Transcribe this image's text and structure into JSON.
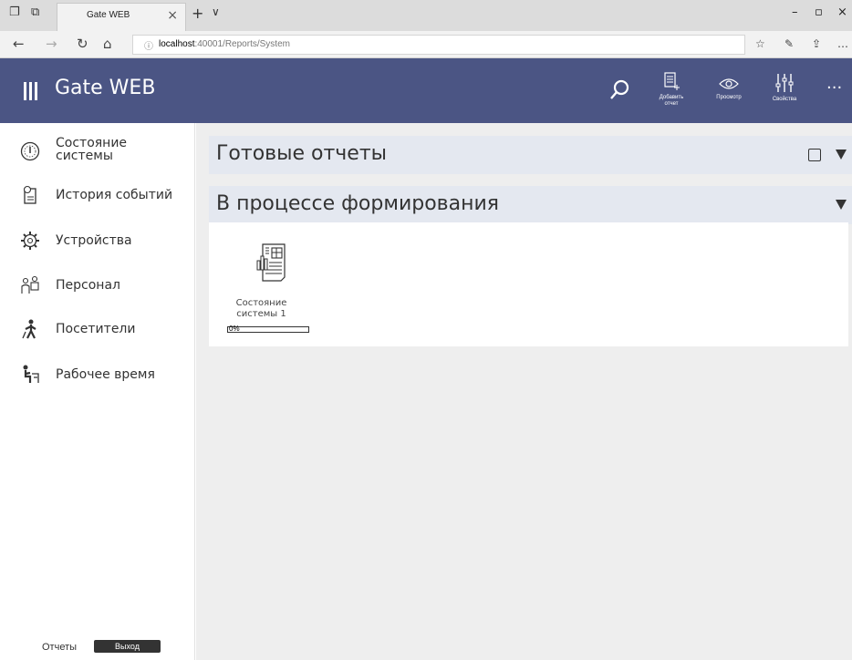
{
  "browser": {
    "tab_title": "Gate WEB",
    "url_host": "localhost",
    "url_path": ":40001/Reports/System"
  },
  "header": {
    "title": "Gate WEB",
    "buttons": {
      "add_report": "Добавить отчет",
      "preview": "Просмотр",
      "properties": "Свойства"
    }
  },
  "sidebar": {
    "items": [
      {
        "label": "Состояние системы",
        "icon": "gauge-icon"
      },
      {
        "label": "История событий",
        "icon": "history-icon"
      },
      {
        "label": "Устройства",
        "icon": "gear-icon"
      },
      {
        "label": "Персонал",
        "icon": "staff-icon"
      },
      {
        "label": "Посетители",
        "icon": "visitor-icon"
      },
      {
        "label": "Рабочее время",
        "icon": "worktime-icon"
      }
    ],
    "footer": {
      "reports_label": "Отчеты",
      "logout_label": "Выход"
    }
  },
  "main": {
    "sections": [
      {
        "title": "Готовые отчеты"
      },
      {
        "title": "В процессе формирования"
      }
    ],
    "in_progress_reports": [
      {
        "name": "Состояние системы 1",
        "progress_text": "0%",
        "progress": 0
      }
    ]
  },
  "colors": {
    "header_bg": "#4b5584",
    "section_head_bg": "#e4e8f0",
    "main_bg": "#eeeeee"
  }
}
